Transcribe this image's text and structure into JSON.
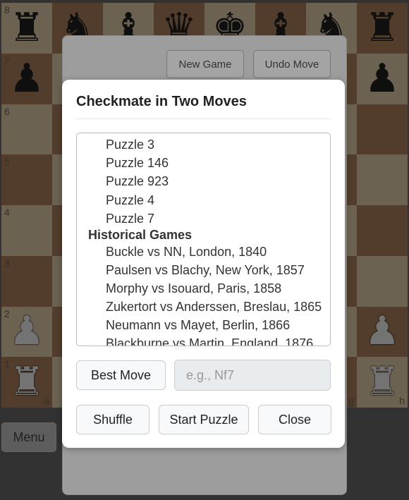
{
  "board": {
    "ranks": [
      "8",
      "7",
      "6",
      "5",
      "4",
      "3",
      "2",
      "1"
    ],
    "files": [
      "a",
      "b",
      "c",
      "d",
      "e",
      "f",
      "g",
      "h"
    ],
    "rank8": [
      "♜",
      "♞",
      "♝",
      "♛",
      "♚",
      "♝",
      "♞",
      "♜"
    ],
    "rank7": [
      "♟",
      "",
      "",
      "",
      "",
      "",
      "",
      "♟"
    ],
    "rank2": [
      "♟",
      "",
      "",
      "",
      "",
      "",
      "",
      "♟"
    ],
    "rank1": [
      "♜",
      "",
      "",
      "",
      "",
      "",
      "",
      "♜"
    ]
  },
  "background": {
    "new_game": "New Game",
    "undo_move": "Undo Move",
    "menu": "Menu"
  },
  "modal": {
    "title": "Checkmate in Two Moves",
    "list_items": [
      {
        "type": "option",
        "label": "Puzzle 3"
      },
      {
        "type": "option",
        "label": "Puzzle 146"
      },
      {
        "type": "option",
        "label": "Puzzle 923"
      },
      {
        "type": "option",
        "label": "Puzzle 4"
      },
      {
        "type": "option",
        "label": "Puzzle 7"
      },
      {
        "type": "group",
        "label": "Historical Games"
      },
      {
        "type": "option",
        "label": "Buckle vs NN, London, 1840"
      },
      {
        "type": "option",
        "label": "Paulsen vs Blachy, New York, 1857"
      },
      {
        "type": "option",
        "label": "Morphy vs Isouard, Paris, 1858"
      },
      {
        "type": "option",
        "label": "Zukertort vs Anderssen, Breslau, 1865"
      },
      {
        "type": "option",
        "label": "Neumann vs Mayet, Berlin, 1866"
      },
      {
        "type": "option",
        "label": "Blackburne vs Martin, England, 1876"
      }
    ],
    "best_move_label": "Best Move",
    "move_placeholder": "e.g., Nf7",
    "shuffle_label": "Shuffle",
    "start_label": "Start Puzzle",
    "close_label": "Close"
  }
}
